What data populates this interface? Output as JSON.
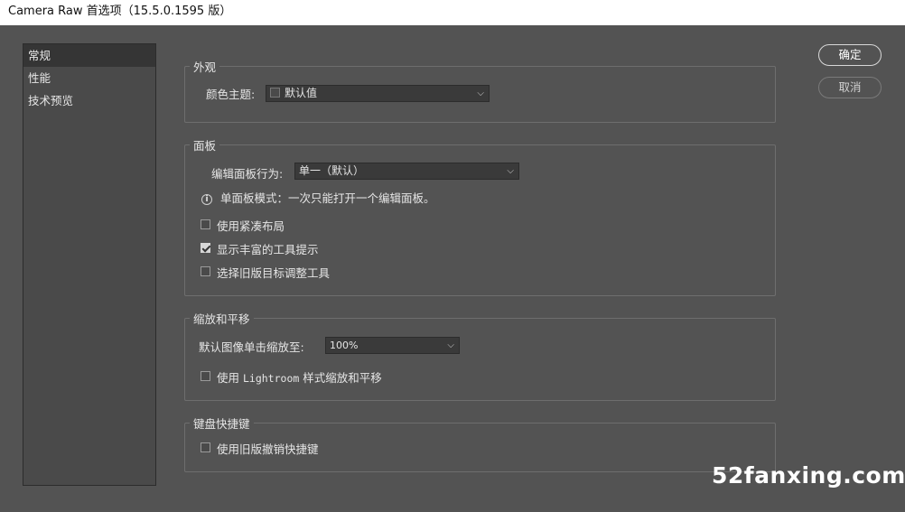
{
  "window": {
    "title": "Camera Raw 首选项（15.5.0.1595 版）"
  },
  "sidebar": {
    "items": [
      {
        "label": "常规",
        "active": true
      },
      {
        "label": "性能",
        "active": false
      },
      {
        "label": "技术预览",
        "active": false
      }
    ]
  },
  "appearance": {
    "legend": "外观",
    "theme_label": "颜色主题:",
    "theme_value": "默认值"
  },
  "panels": {
    "legend": "面板",
    "behavior_label": "编辑面板行为:",
    "behavior_value": "单一（默认）",
    "info_text": "单面板模式：一次只能打开一个编辑面板。",
    "compact_layout": {
      "label": "使用紧凑布局",
      "checked": false
    },
    "rich_tooltips": {
      "label": "显示丰富的工具提示",
      "checked": true
    },
    "legacy_tat": {
      "label": "选择旧版目标调整工具",
      "checked": false
    }
  },
  "zoom": {
    "legend": "缩放和平移",
    "default_zoom_label": "默认图像单击缩放至:",
    "default_zoom_value": "100%",
    "lightroom_style": {
      "label_prefix": "使用 ",
      "label_mono": "Lightroom",
      "label_suffix": " 样式缩放和平移",
      "checked": false
    }
  },
  "shortcuts": {
    "legend": "键盘快捷键",
    "legacy_undo": {
      "label": "使用旧版撤销快捷键",
      "checked": false
    }
  },
  "buttons": {
    "ok": "确定",
    "cancel": "取消"
  },
  "icons": {
    "dropdown": "chevron-down-icon",
    "info": "info-icon",
    "check": "checkmark-icon"
  },
  "watermark": "52fanxing.com"
}
